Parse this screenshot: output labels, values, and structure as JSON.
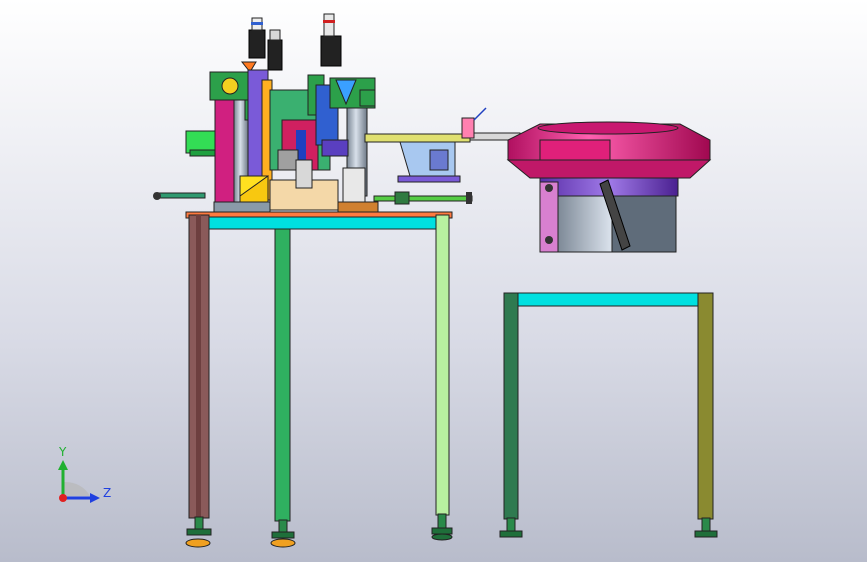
{
  "viewport": {
    "background_top": "#ffffff",
    "background_bottom": "#b8bccb"
  },
  "triad": {
    "y_label": "Y",
    "z_label": "Z",
    "y_color": "#20b030",
    "z_color": "#2040e0",
    "x_color": "#e02020"
  },
  "colors": {
    "table_top": "#00e0e0",
    "bowl": "#e0207a",
    "bowl_base": "#7b4fd0",
    "bowl_body": "#8a98a8",
    "frame_outline": "#222222"
  }
}
